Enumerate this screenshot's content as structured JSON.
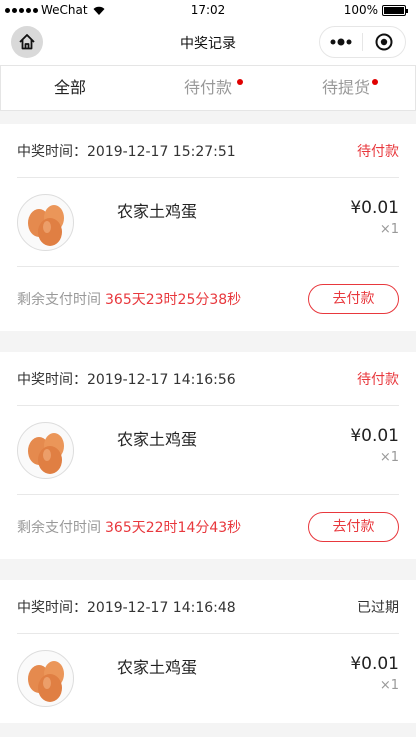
{
  "status_bar": {
    "carrier": "WeChat",
    "time": "17:02",
    "battery": "100%"
  },
  "nav": {
    "title": "中奖记录"
  },
  "tabs": [
    {
      "label": "全部",
      "active": true,
      "dot": false
    },
    {
      "label": "待付款",
      "active": false,
      "dot": true
    },
    {
      "label": "待提货",
      "active": false,
      "dot": true
    }
  ],
  "colors": {
    "accent": "#e8383d",
    "badge_dot": "#e00000"
  },
  "orders": [
    {
      "time_label": "中奖时间：",
      "time": "2019-12-17 15:27:51",
      "status": "待付款",
      "product": "农家土鸡蛋",
      "price": "¥0.01",
      "qty": "×1",
      "remain_label": "剩余支付时间",
      "countdown": "365天23时25分38秒",
      "action": "去付款"
    },
    {
      "time_label": "中奖时间：",
      "time": "2019-12-17 14:16:56",
      "status": "待付款",
      "product": "农家土鸡蛋",
      "price": "¥0.01",
      "qty": "×1",
      "remain_label": "剩余支付时间",
      "countdown": "365天22时14分43秒",
      "action": "去付款"
    },
    {
      "time_label": "中奖时间：",
      "time": "2019-12-17 14:16:48",
      "status": "已过期",
      "product": "农家土鸡蛋",
      "price": "¥0.01",
      "qty": "×1"
    }
  ]
}
